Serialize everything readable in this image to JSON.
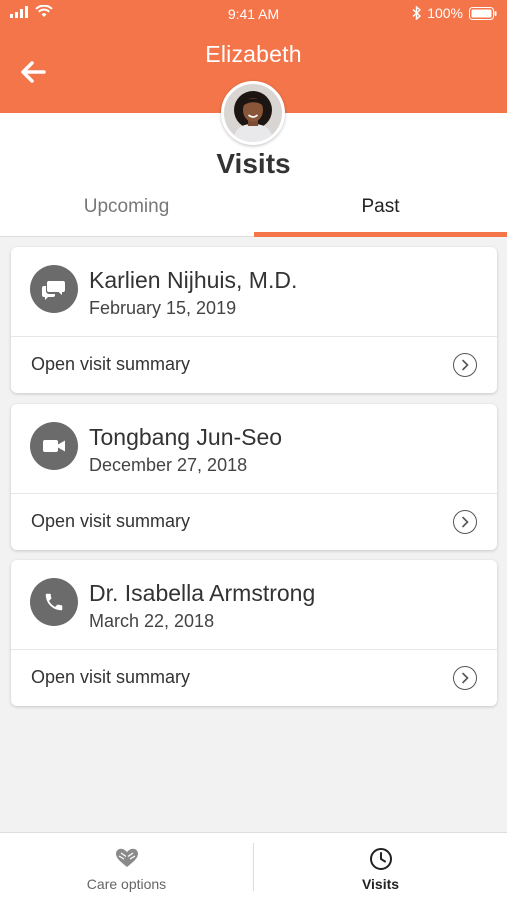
{
  "status_bar": {
    "time": "9:41 AM",
    "battery": "100%"
  },
  "header": {
    "title": "Elizabeth",
    "back_icon": "arrow-left-icon"
  },
  "page_title": "Visits",
  "tabs": [
    {
      "label": "Upcoming",
      "selected": false
    },
    {
      "label": "Past",
      "selected": true
    }
  ],
  "visits": [
    {
      "name": "Karlien Nijhuis, M.D.",
      "date": "February 15, 2019",
      "icon": "chat-bubbles-icon",
      "action_label": "Open visit summary"
    },
    {
      "name": "Tongbang Jun-Seo",
      "date": "December 27, 2018",
      "icon": "video-camera-icon",
      "action_label": "Open visit summary"
    },
    {
      "name": "Dr. Isabella Armstrong",
      "date": "March 22, 2018",
      "icon": "phone-icon",
      "action_label": "Open visit summary"
    }
  ],
  "bottom_nav": [
    {
      "label": "Care options",
      "icon": "heart-hands-icon",
      "active": false
    },
    {
      "label": "Visits",
      "icon": "clock-icon",
      "active": true
    }
  ],
  "colors": {
    "accent": "#f4754a",
    "icon_bg": "#6b6b6b",
    "background": "#f2f2f2"
  }
}
